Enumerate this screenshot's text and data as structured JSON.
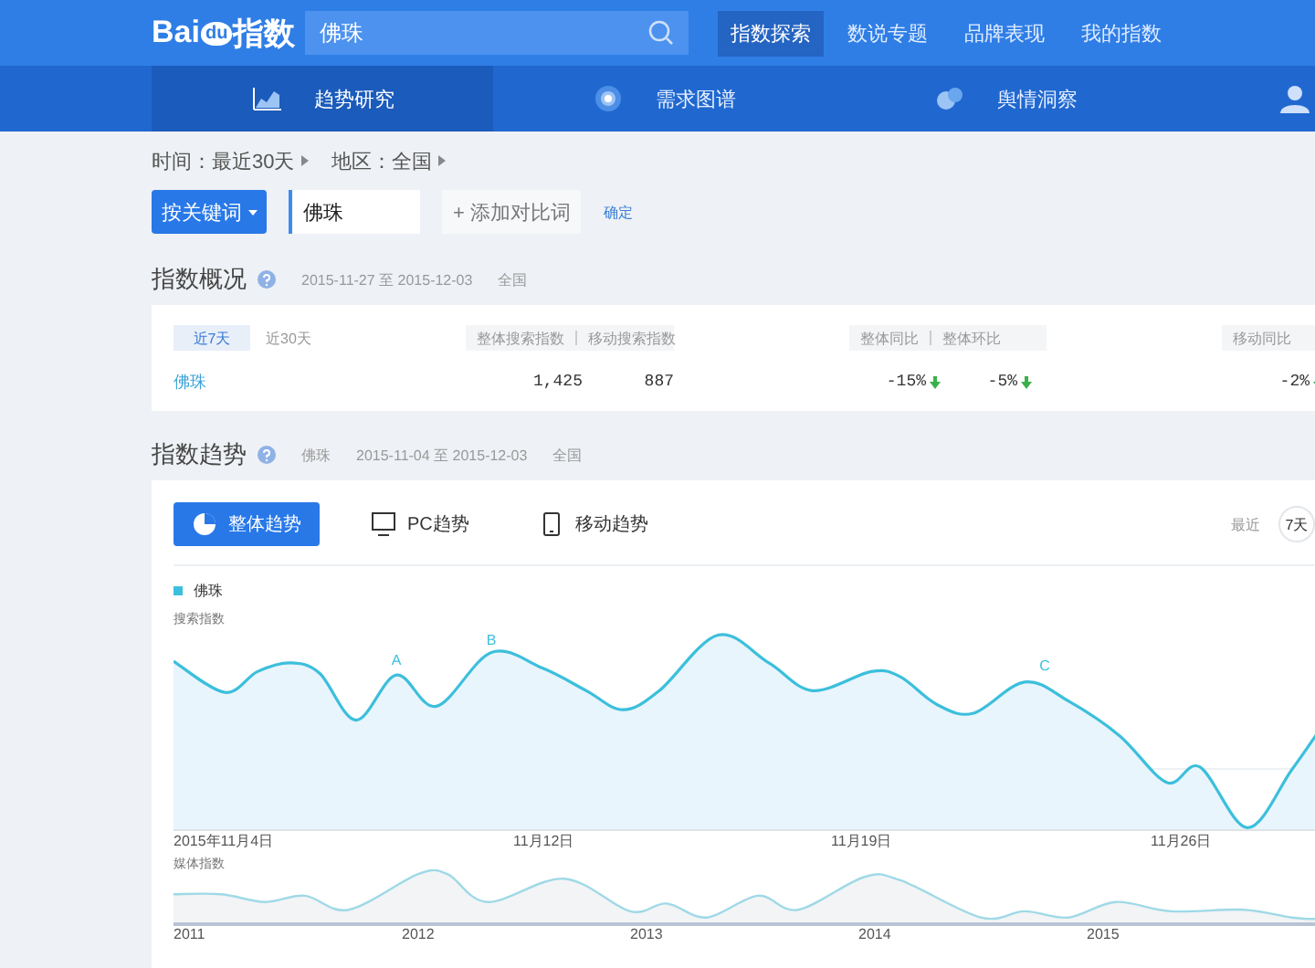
{
  "header": {
    "logo": {
      "left": "Bai",
      "badge": "du",
      "right": "指数"
    },
    "search_value": "佛珠",
    "nav": [
      {
        "label": "指数探索",
        "selected": true
      },
      {
        "label": "数说专题",
        "selected": false
      },
      {
        "label": "品牌表现",
        "selected": false
      },
      {
        "label": "我的指数",
        "selected": false
      }
    ]
  },
  "subnav": [
    {
      "label": "趋势研究",
      "selected": true
    },
    {
      "label": "需求图谱",
      "selected": false
    },
    {
      "label": "舆情洞察",
      "selected": false
    }
  ],
  "filters": [
    {
      "label": "时间：最近30天"
    },
    {
      "label": "地区：全国"
    }
  ],
  "keyword_bar": {
    "mode_button": "按关键词",
    "keyword": "佛珠",
    "add_button": "+ 添加对比词",
    "confirm": "确定"
  },
  "overview": {
    "title": "指数概况",
    "date_range": "2015-11-27 至 2015-12-03",
    "region": "全国",
    "periods": [
      {
        "label": "近7天",
        "selected": true
      },
      {
        "label": "近30天",
        "selected": false
      }
    ],
    "column_groups": [
      [
        "整体搜索指数",
        "移动搜索指数"
      ],
      [
        "整体同比",
        "整体环比"
      ],
      [
        "移动同比"
      ]
    ],
    "row": {
      "keyword": "佛珠",
      "groups": [
        [
          {
            "value": "1,425"
          },
          {
            "value": "887"
          }
        ],
        [
          {
            "value": "-15%",
            "falling": true
          },
          {
            "value": "-5%",
            "falling": true
          }
        ],
        [
          {
            "value": "-2%",
            "falling": true
          }
        ]
      ]
    }
  },
  "trend": {
    "title": "指数趋势",
    "keyword": "佛珠",
    "date_range": "2015-11-04 至 2015-12-03",
    "region": "全国",
    "tabs": [
      {
        "label": "整体趋势",
        "selected": true
      },
      {
        "label": "PC趋势",
        "selected": false
      },
      {
        "label": "移动趋势",
        "selected": false
      }
    ],
    "range_label": "最近",
    "range_button": "7天",
    "legend": {
      "label": "佛珠",
      "color": "#3cbfdc"
    },
    "y_label": "搜索指数",
    "markers": [
      "A",
      "B",
      "C"
    ],
    "x_labels": [
      "2015年11月4日",
      "11月12日",
      "11月19日",
      "11月26日"
    ],
    "media_label": "媒体指数",
    "years": [
      "2011",
      "2012",
      "2013",
      "2014",
      "2015"
    ]
  }
}
